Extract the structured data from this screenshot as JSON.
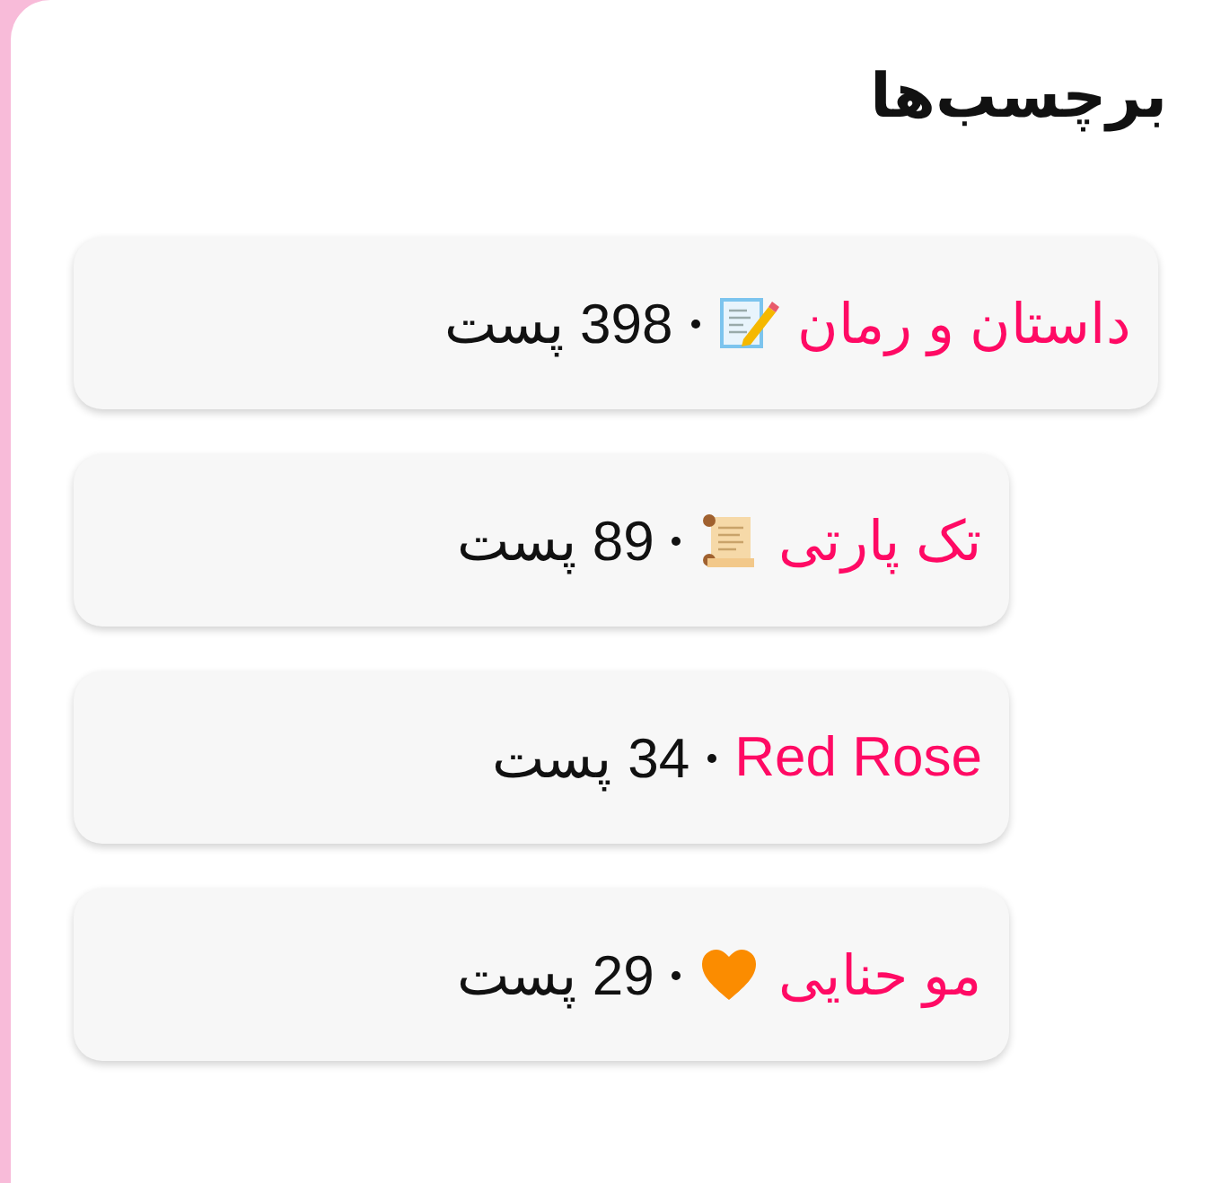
{
  "title": "برچسب‌ها",
  "tags": [
    {
      "kind": "memo",
      "name": "داستان و رمان",
      "count": "398 پست"
    },
    {
      "kind": "scroll",
      "name": "تک پارتی",
      "count": "89 پست"
    },
    {
      "kind": "plain",
      "name": "Red Rose",
      "count": "34 پست"
    },
    {
      "kind": "heart",
      "name": "مو حنایی",
      "count": "29 پست"
    }
  ]
}
